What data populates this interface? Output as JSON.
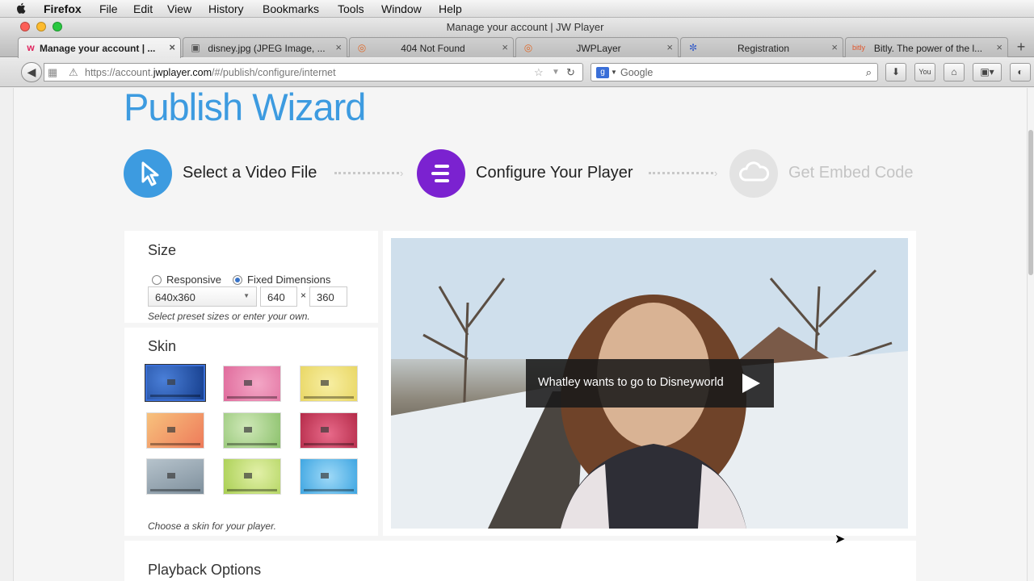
{
  "menubar": {
    "app": "Firefox",
    "items": [
      "File",
      "Edit",
      "View",
      "History",
      "Bookmarks",
      "Tools",
      "Window",
      "Help"
    ]
  },
  "window": {
    "title": "Manage your account | JW Player"
  },
  "tabs": [
    {
      "label": "Manage your account | ...",
      "icon": "jw-favicon",
      "active": true
    },
    {
      "label": "disney.jpg (JPEG Image, ...",
      "icon": "image-favicon",
      "active": false
    },
    {
      "label": "404 Not Found",
      "icon": "firefox-favicon",
      "active": false
    },
    {
      "label": "JWPLayer",
      "icon": "firefox-favicon",
      "active": false
    },
    {
      "label": "Registration",
      "icon": "gear-favicon",
      "active": false
    },
    {
      "label": "Bitly. The power of the l...",
      "icon": "bitly-favicon",
      "active": false
    }
  ],
  "navbar": {
    "url_prefix": "https://account.",
    "url_domain": "jwplayer.com",
    "url_path": "/#/publish/configure/internet",
    "search_placeholder": "Google"
  },
  "page": {
    "title": "Publish Wizard",
    "steps": [
      {
        "label": "Select a Video File",
        "icon": "cursor-icon",
        "color": "#3d9be0"
      },
      {
        "label": "Configure Your Player",
        "icon": "layers-icon",
        "color": "#7b22d0"
      },
      {
        "label": "Get Embed Code",
        "icon": "cloud-icon",
        "color": "#e3e3e3"
      }
    ],
    "size": {
      "heading": "Size",
      "option_responsive": "Responsive",
      "option_fixed": "Fixed Dimensions",
      "selected": "Fixed Dimensions",
      "preset": "640x360",
      "width": "640",
      "times": "×",
      "height": "360",
      "hint": "Select preset sizes or enter your own."
    },
    "skin": {
      "heading": "Skin",
      "hint": "Choose a skin for your player.",
      "options": [
        {
          "name": "blue-dark",
          "color": "#1d4fa6",
          "selected": true
        },
        {
          "name": "pink",
          "color": "#e67aa8",
          "selected": false
        },
        {
          "name": "yellow",
          "color": "#f0e27a",
          "selected": false
        },
        {
          "name": "orange",
          "color": "#f39a5c",
          "selected": false
        },
        {
          "name": "green-light",
          "color": "#a9d18c",
          "selected": false
        },
        {
          "name": "red",
          "color": "#c93a5a",
          "selected": false
        },
        {
          "name": "gray-blue",
          "color": "#8fa0ae",
          "selected": false
        },
        {
          "name": "lime",
          "color": "#b8d96a",
          "selected": false
        },
        {
          "name": "sky",
          "color": "#55b8ea",
          "selected": false
        }
      ]
    },
    "video": {
      "caption": "Whatley wants to go to Disneyworld"
    },
    "playback": {
      "heading": "Playback Options"
    }
  }
}
